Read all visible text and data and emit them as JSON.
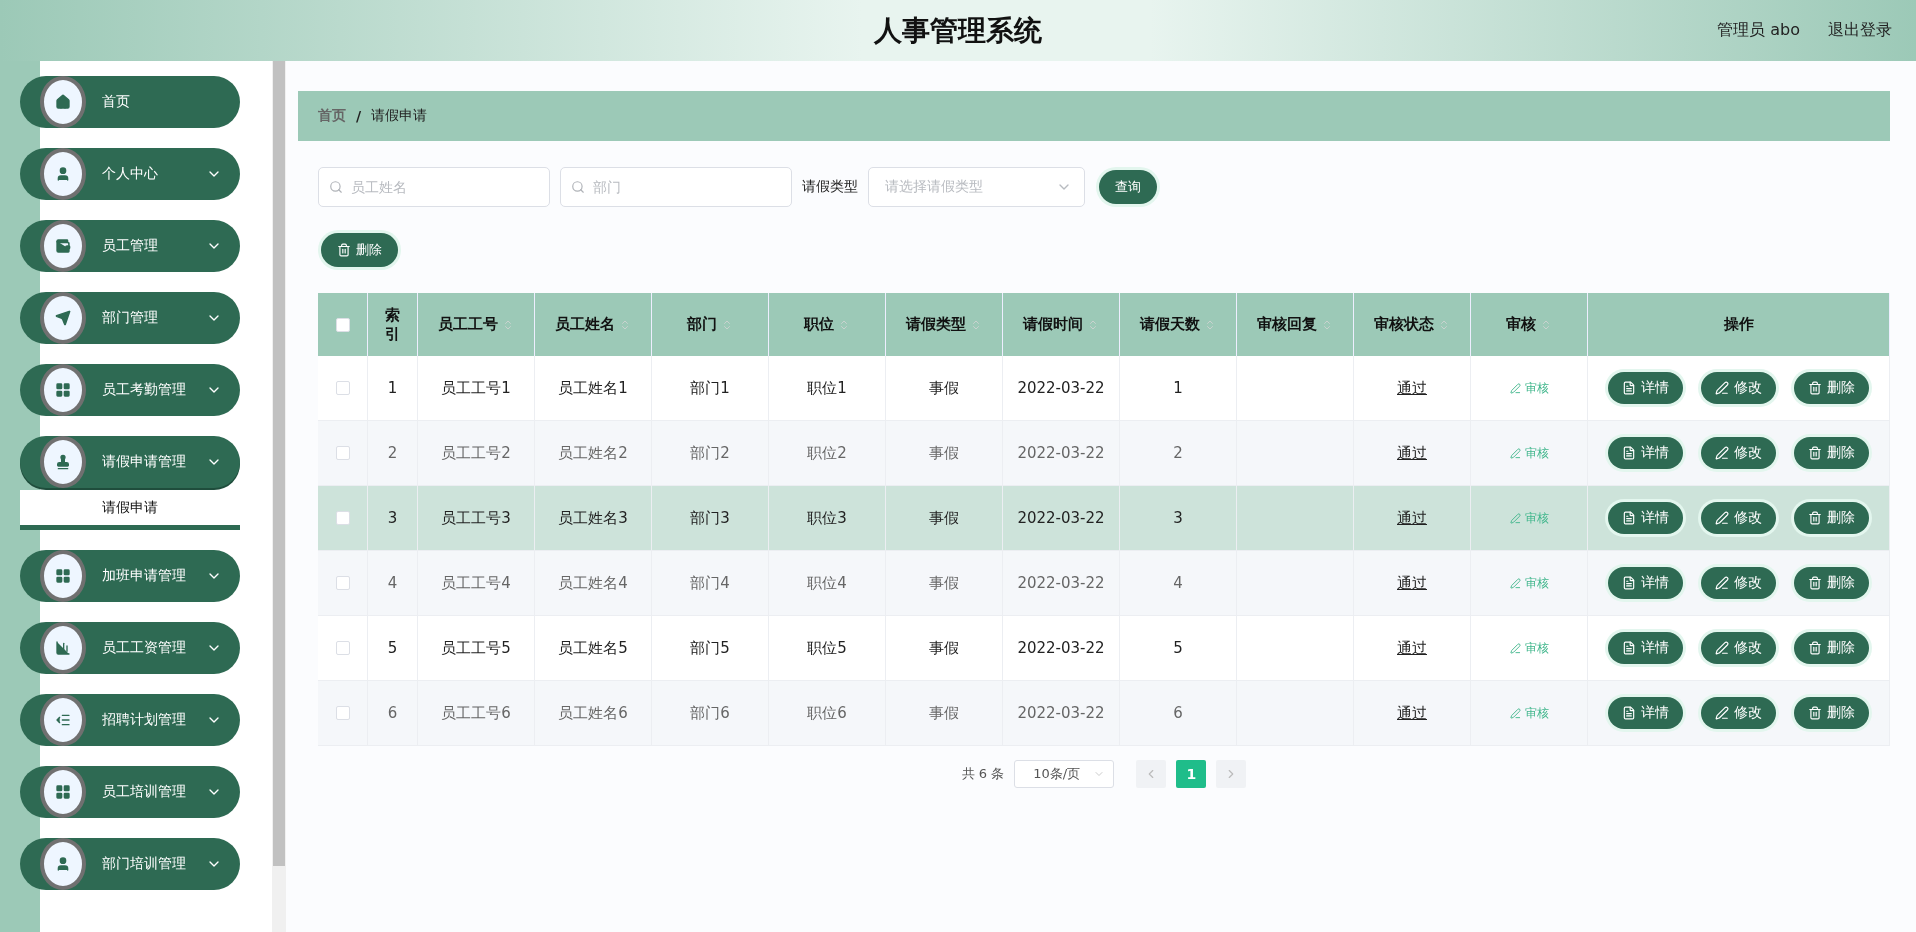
{
  "header": {
    "title": "人事管理系统",
    "user": "管理员 abo",
    "logout": "退出登录"
  },
  "sidebar": {
    "items": [
      {
        "label": "首页",
        "kind": "link"
      },
      {
        "label": "个人中心",
        "kind": "submenu"
      },
      {
        "label": "员工管理",
        "kind": "submenu"
      },
      {
        "label": "部门管理",
        "kind": "submenu"
      },
      {
        "label": "员工考勤管理",
        "kind": "submenu"
      },
      {
        "label": "请假申请管理",
        "kind": "submenu",
        "expanded": true,
        "children": [
          {
            "label": "请假申请",
            "selected": true
          }
        ]
      },
      {
        "label": "加班申请管理",
        "kind": "submenu"
      },
      {
        "label": "员工工资管理",
        "kind": "submenu"
      },
      {
        "label": "招聘计划管理",
        "kind": "submenu"
      },
      {
        "label": "员工培训管理",
        "kind": "submenu"
      },
      {
        "label": "部门培训管理",
        "kind": "submenu"
      }
    ]
  },
  "breadcrumb": {
    "separator": "/",
    "items": [
      "首页",
      "请假申请"
    ]
  },
  "filters": {
    "name": {
      "placeholder": "员工姓名"
    },
    "dept": {
      "placeholder": "部门"
    },
    "type_label": "请假类型",
    "type": {
      "placeholder": "请选择请假类型"
    },
    "search_button": "查询"
  },
  "delete_button": "删除",
  "table": {
    "select_all": {
      "checked": false
    },
    "columns": [
      {
        "label": "索引",
        "sortable": false
      },
      {
        "label": "员工工号",
        "sortable": true
      },
      {
        "label": "员工姓名",
        "sortable": true
      },
      {
        "label": "部门",
        "sortable": true
      },
      {
        "label": "职位",
        "sortable": true
      },
      {
        "label": "请假类型",
        "sortable": true
      },
      {
        "label": "请假时间",
        "sortable": true
      },
      {
        "label": "请假天数",
        "sortable": true
      },
      {
        "label": "审核回复",
        "sortable": true
      },
      {
        "label": "审核状态",
        "sortable": true
      },
      {
        "label": "审核",
        "sortable": true
      },
      {
        "label": "操作",
        "sortable": false
      }
    ],
    "rows": [
      {
        "checked": false,
        "highlighted": false,
        "cells": [
          "1",
          "员工工号1",
          "员工姓名1",
          "部门1",
          "职位1",
          "事假",
          "2022-03-22",
          "1",
          "",
          "通过"
        ],
        "review": "审核",
        "actions": [
          "详情",
          "修改",
          "删除"
        ]
      },
      {
        "checked": false,
        "highlighted": false,
        "cells": [
          "2",
          "员工工号2",
          "员工姓名2",
          "部门2",
          "职位2",
          "事假",
          "2022-03-22",
          "2",
          "",
          "通过"
        ],
        "review": "审核",
        "actions": [
          "详情",
          "修改",
          "删除"
        ]
      },
      {
        "checked": false,
        "highlighted": true,
        "cells": [
          "3",
          "员工工号3",
          "员工姓名3",
          "部门3",
          "职位3",
          "事假",
          "2022-03-22",
          "3",
          "",
          "通过"
        ],
        "review": "审核",
        "actions": [
          "详情",
          "修改",
          "删除"
        ]
      },
      {
        "checked": false,
        "highlighted": false,
        "cells": [
          "4",
          "员工工号4",
          "员工姓名4",
          "部门4",
          "职位4",
          "事假",
          "2022-03-22",
          "4",
          "",
          "通过"
        ],
        "review": "审核",
        "actions": [
          "详情",
          "修改",
          "删除"
        ]
      },
      {
        "checked": false,
        "highlighted": false,
        "cells": [
          "5",
          "员工工号5",
          "员工姓名5",
          "部门5",
          "职位5",
          "事假",
          "2022-03-22",
          "5",
          "",
          "通过"
        ],
        "review": "审核",
        "actions": [
          "详情",
          "修改",
          "删除"
        ]
      },
      {
        "checked": false,
        "highlighted": false,
        "cells": [
          "6",
          "员工工号6",
          "员工姓名6",
          "部门6",
          "职位6",
          "事假",
          "2022-03-22",
          "6",
          "",
          "通过"
        ],
        "review": "审核",
        "actions": [
          "详情",
          "修改",
          "删除"
        ]
      }
    ]
  },
  "pagination": {
    "total": "共 6 条",
    "page_size": "10条/页",
    "pages": [
      {
        "label": "1",
        "selected": true
      }
    ]
  }
}
